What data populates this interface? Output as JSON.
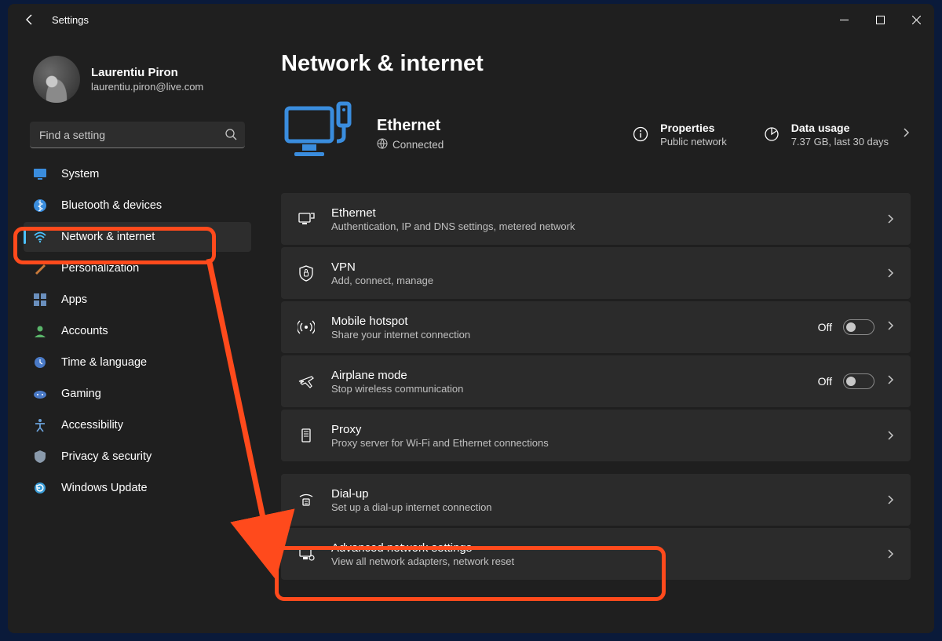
{
  "window": {
    "title": "Settings"
  },
  "user": {
    "name": "Laurentiu Piron",
    "email": "laurentiu.piron@live.com"
  },
  "search": {
    "placeholder": "Find a setting"
  },
  "sidebar": {
    "items": [
      {
        "label": "System"
      },
      {
        "label": "Bluetooth & devices"
      },
      {
        "label": "Network & internet"
      },
      {
        "label": "Personalization"
      },
      {
        "label": "Apps"
      },
      {
        "label": "Accounts"
      },
      {
        "label": "Time & language"
      },
      {
        "label": "Gaming"
      },
      {
        "label": "Accessibility"
      },
      {
        "label": "Privacy & security"
      },
      {
        "label": "Windows Update"
      }
    ]
  },
  "page": {
    "title": "Network & internet"
  },
  "hero": {
    "connection_name": "Ethernet",
    "status": "Connected",
    "properties": {
      "title": "Properties",
      "sub": "Public network"
    },
    "usage": {
      "title": "Data usage",
      "sub": "7.37 GB, last 30 days"
    }
  },
  "rows": [
    {
      "title": "Ethernet",
      "sub": "Authentication, IP and DNS settings, metered network"
    },
    {
      "title": "VPN",
      "sub": "Add, connect, manage"
    },
    {
      "title": "Mobile hotspot",
      "sub": "Share your internet connection",
      "toggle": "Off"
    },
    {
      "title": "Airplane mode",
      "sub": "Stop wireless communication",
      "toggle": "Off"
    },
    {
      "title": "Proxy",
      "sub": "Proxy server for Wi-Fi and Ethernet connections"
    },
    {
      "title": "Dial-up",
      "sub": "Set up a dial-up internet connection"
    },
    {
      "title": "Advanced network settings",
      "sub": "View all network adapters, network reset"
    }
  ]
}
